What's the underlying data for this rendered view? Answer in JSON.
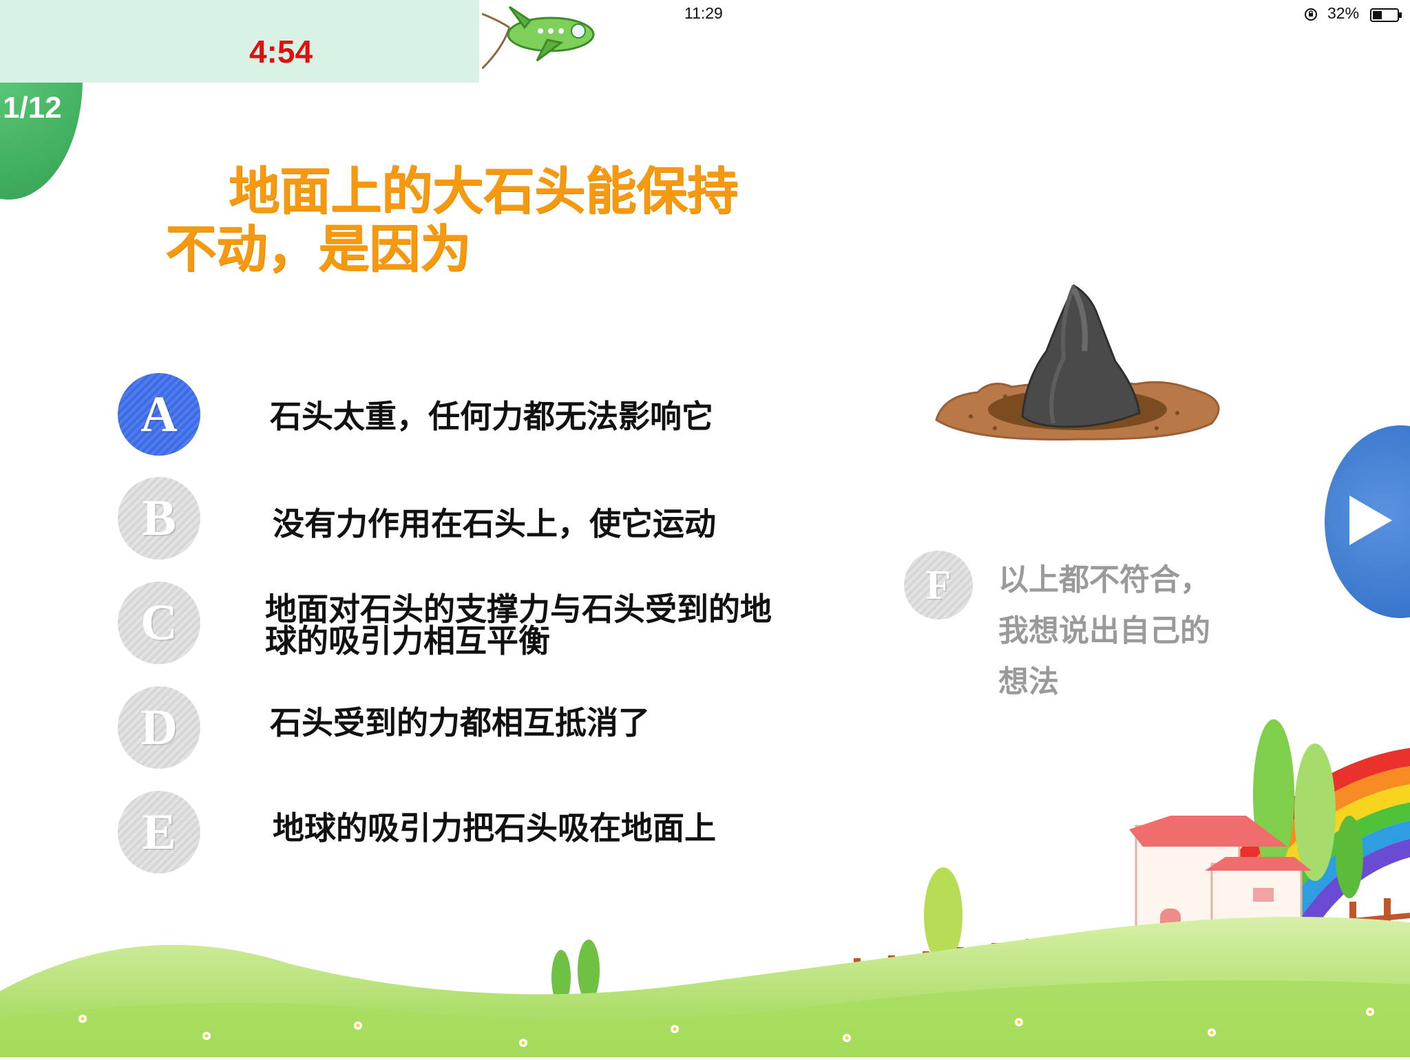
{
  "status_bar": {
    "device": "iPad",
    "time": "11:29",
    "battery_percent": "32%",
    "icons": [
      "wifi-icon",
      "orientation-lock-icon",
      "battery-icon"
    ]
  },
  "quiz": {
    "progress": "1/12",
    "timer": "4:54",
    "question": {
      "line1": "地面上的大石头能保持",
      "line2": "不动，是因为"
    },
    "options": [
      {
        "letter": "A",
        "text": "石头太重，任何力都无法影响它",
        "selected": true
      },
      {
        "letter": "B",
        "text": "没有力作用在石头上，使它运动",
        "selected": false
      },
      {
        "letter": "C",
        "text_line1": "地面对石头的支撑力与石头受到的地",
        "text_line2": "球的吸引力相互平衡",
        "selected": false
      },
      {
        "letter": "D",
        "text": "石头受到的力都相互抵消了",
        "selected": false
      },
      {
        "letter": "E",
        "text": "地球的吸引力把石头吸在地面上",
        "selected": false
      }
    ],
    "option_f": {
      "letter": "F",
      "line1": "以上都不符合，",
      "line2": "我想说出自己的",
      "line3": "想法"
    }
  },
  "colors": {
    "accent_orange": "#f59a10",
    "selected_blue": "#4f7bf0",
    "timer_red": "#e01010",
    "progress_green": "#3fae5d",
    "next_blue": "#3b78cc"
  }
}
